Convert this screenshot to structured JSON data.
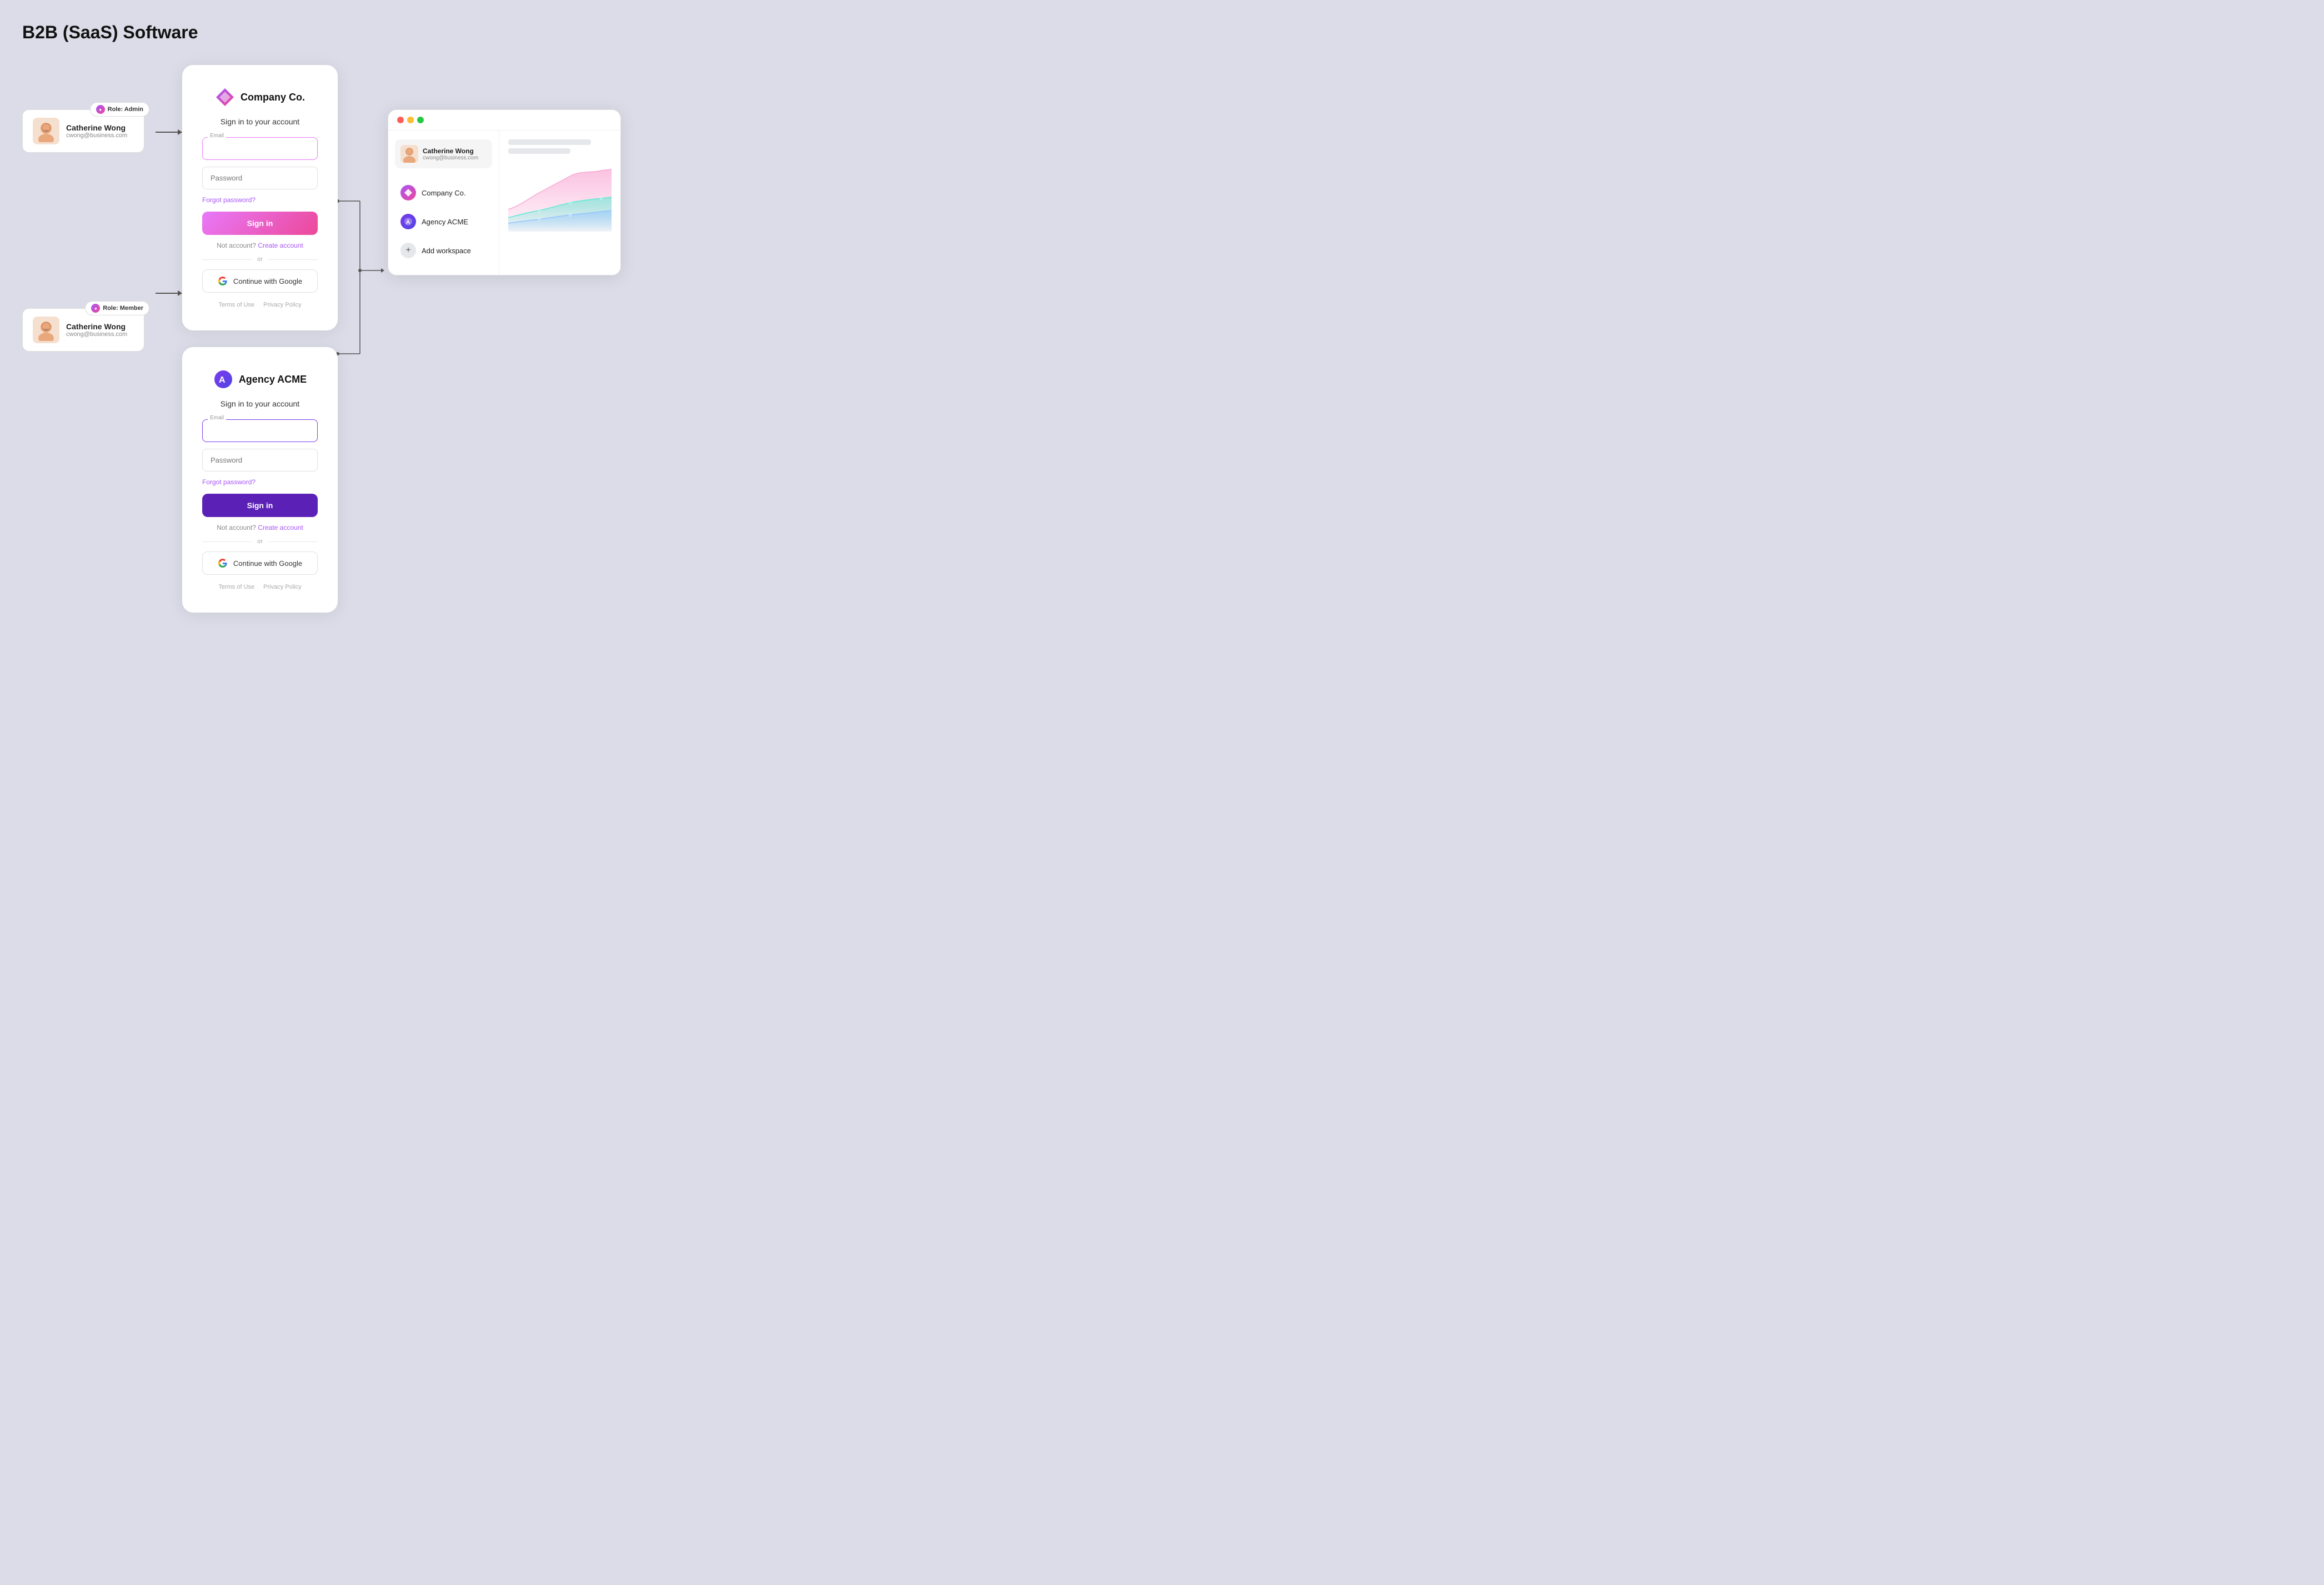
{
  "page": {
    "title": "B2B (SaaS) Software"
  },
  "user": {
    "name": "Catherine Wong",
    "email": "cwong@business.com"
  },
  "roles": {
    "admin": "Role: Admin",
    "member": "Role: Member"
  },
  "company_login": {
    "logo_name": "Company Co.",
    "subtitle": "Sign in to your account",
    "email_label": "Email",
    "password_placeholder": "Password",
    "forgot_password": "Forgot password?",
    "sign_in": "Sign in",
    "no_account": "Not account?",
    "create_account": "Create account",
    "or": "or",
    "google_btn": "Continue with Google",
    "terms": "Terms of Use",
    "privacy": "Privacy Policy"
  },
  "agency_login": {
    "logo_name": "Agency ACME",
    "subtitle": "Sign in to your account",
    "email_label": "Email",
    "password_placeholder": "Password",
    "forgot_password": "Forgot password?",
    "sign_in": "Sign in",
    "no_account": "Not account?",
    "create_account": "Create account",
    "or": "or",
    "google_btn": "Continue with Google",
    "terms": "Terms of Use",
    "privacy": "Privacy Policy"
  },
  "app_window": {
    "user_name": "Catherine Wong",
    "user_email": "cwong@business.com",
    "workspaces": [
      {
        "name": "Company Co.",
        "type": "company"
      },
      {
        "name": "Agency ACME",
        "type": "agency"
      }
    ],
    "add_workspace": "Add workspace"
  }
}
